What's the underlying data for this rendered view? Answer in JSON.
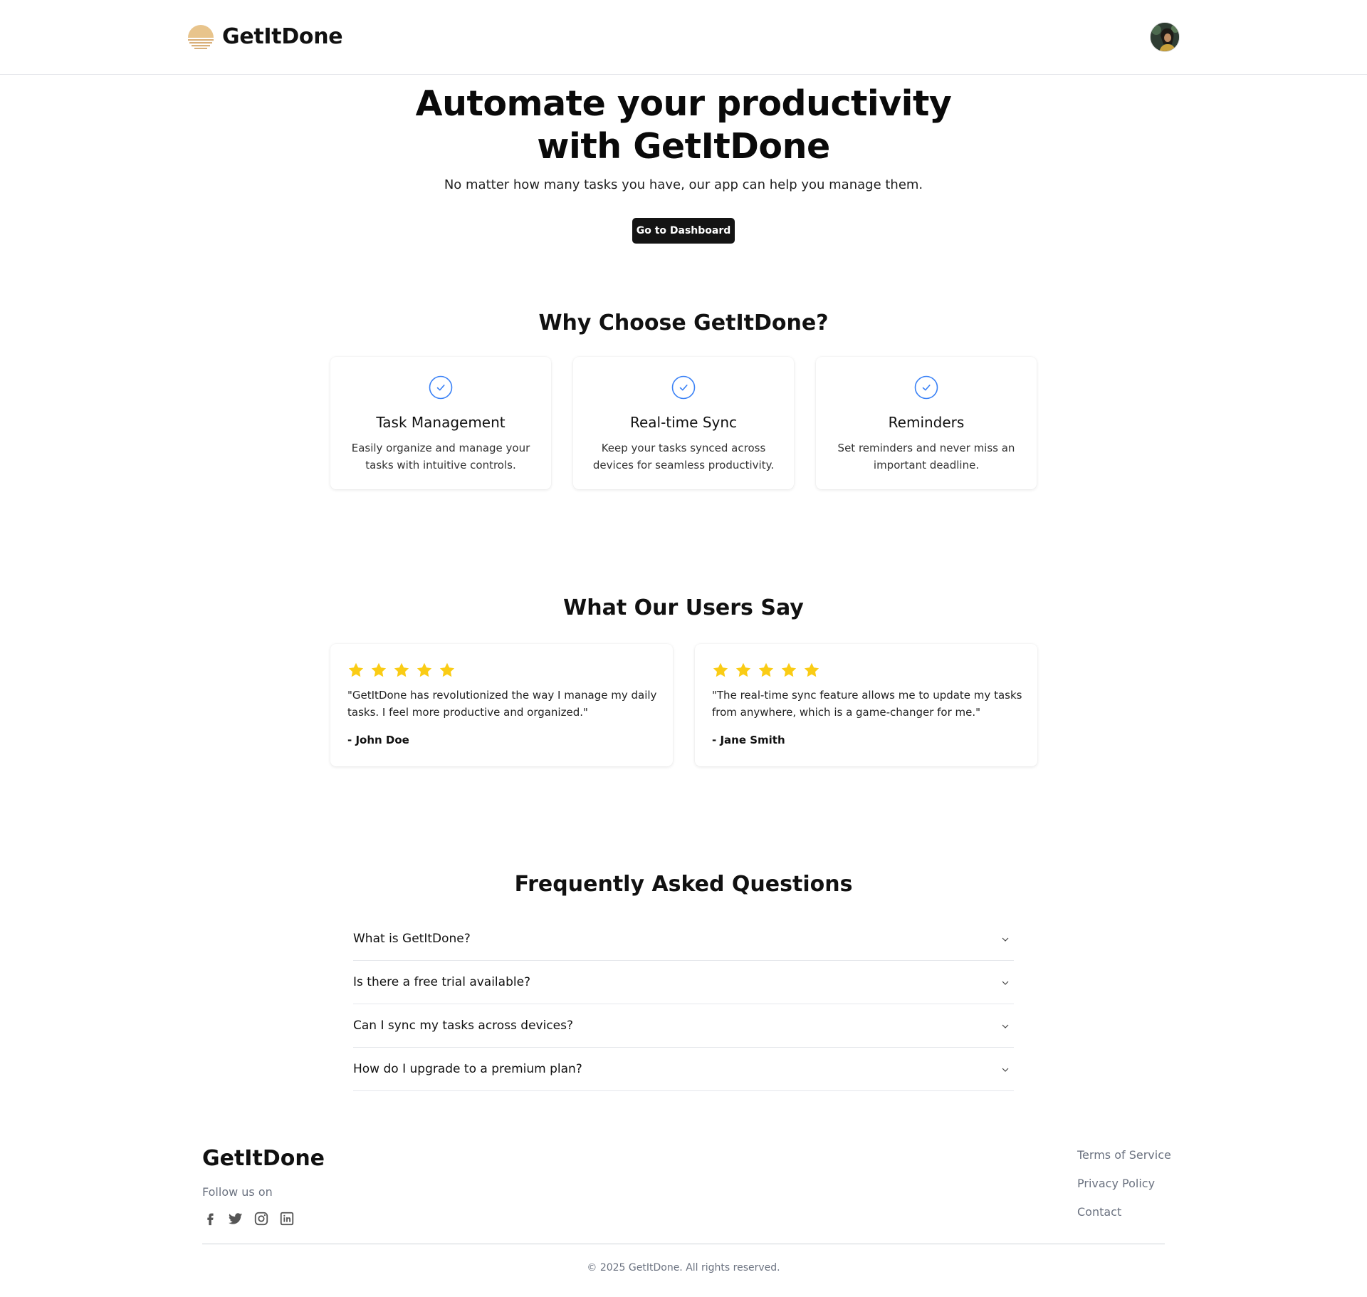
{
  "header": {
    "brand_name": "GetItDone",
    "logo_icon": "sunset-logo-icon",
    "avatar_icon": "user-avatar"
  },
  "hero": {
    "title_line1": "Automate your productivity",
    "title_line2": "with GetItDone",
    "subtitle": "No matter how many tasks you have, our app can help you manage them.",
    "cta_label": "Go to Dashboard"
  },
  "features": {
    "title": "Why Choose GetItDone?",
    "icon": "check-circle-icon",
    "items": [
      {
        "title": "Task Management",
        "desc": "Easily organize and manage your tasks with intuitive controls."
      },
      {
        "title": "Real-time Sync",
        "desc": "Keep your tasks synced across devices for seamless productivity."
      },
      {
        "title": "Reminders",
        "desc": "Set reminders and never miss an important deadline."
      }
    ]
  },
  "testimonials": {
    "title": "What Our Users Say",
    "items": [
      {
        "rating": 5,
        "quote": "\"GetItDone has revolutionized the way I manage my daily tasks. I feel more productive and organized.\"",
        "author": "- John Doe"
      },
      {
        "rating": 5,
        "quote": "\"The real-time sync feature allows me to update my tasks from anywhere, which is a game-changer for me.\"",
        "author": "- Jane Smith"
      }
    ]
  },
  "faq": {
    "title": "Frequently Asked Questions",
    "items": [
      {
        "question": "What is GetItDone?"
      },
      {
        "question": "Is there a free trial available?"
      },
      {
        "question": "Can I sync my tasks across devices?"
      },
      {
        "question": "How do I upgrade to a premium plan?"
      }
    ]
  },
  "footer": {
    "brand_name": "GetItDone",
    "follow_label": "Follow us on",
    "socials": [
      "facebook-icon",
      "twitter-icon",
      "instagram-icon",
      "linkedin-icon"
    ],
    "links": [
      "Terms of Service",
      "Privacy Policy",
      "Contact"
    ],
    "copyright": "© 2025 GetItDone. All rights reserved."
  },
  "colors": {
    "accent_blue": "#3b82f6",
    "star_yellow": "#facc15",
    "cta_background": "#141414",
    "logo_sand": "#e8c48c"
  }
}
